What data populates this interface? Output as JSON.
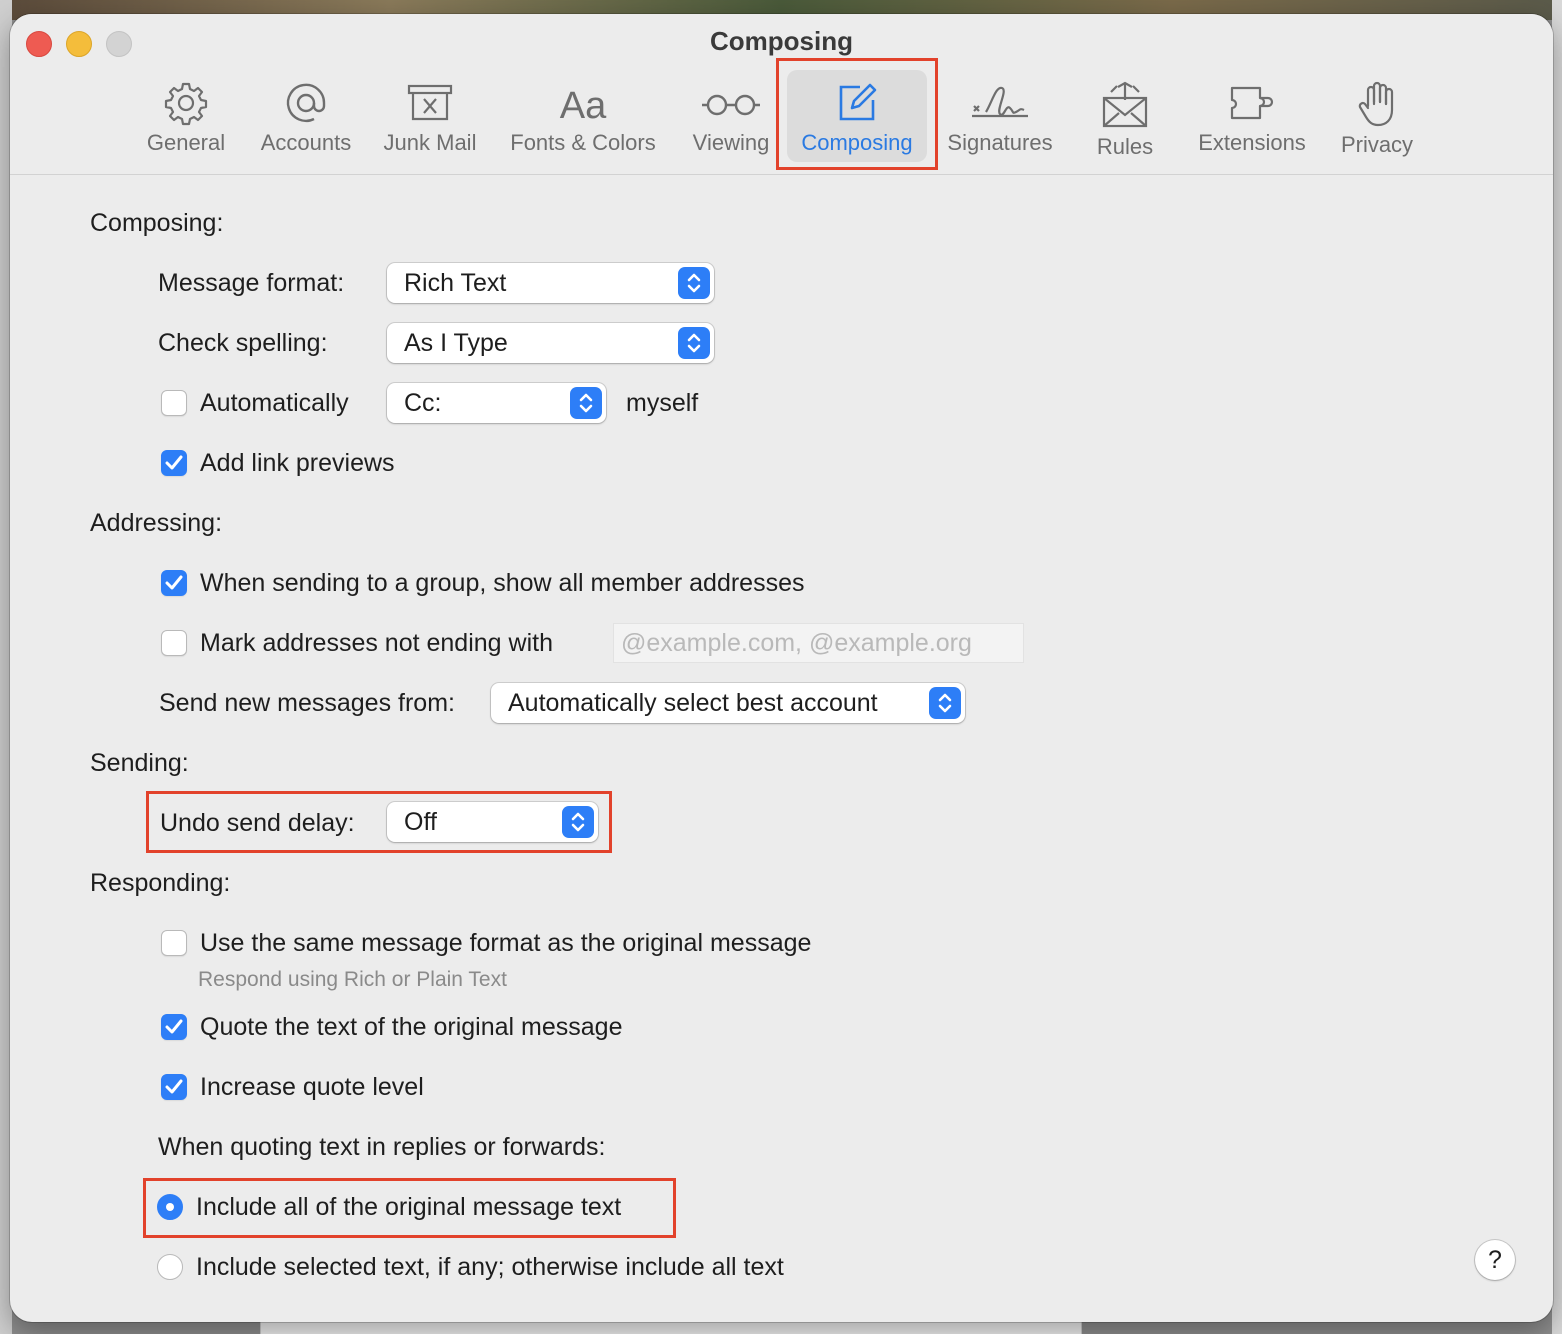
{
  "window": {
    "title": "Composing"
  },
  "toolbar": {
    "tabs": [
      {
        "label": "General",
        "icon": "gear-icon"
      },
      {
        "label": "Accounts",
        "icon": "at-sign-icon"
      },
      {
        "label": "Junk Mail",
        "icon": "junk-bin-icon"
      },
      {
        "label": "Fonts & Colors",
        "icon": "font-aa-icon"
      },
      {
        "label": "Viewing",
        "icon": "glasses-icon"
      },
      {
        "label": "Composing",
        "icon": "compose-pencil-icon",
        "selected": true
      },
      {
        "label": "Signatures",
        "icon": "signature-icon"
      },
      {
        "label": "Rules",
        "icon": "rules-envelope-icon"
      },
      {
        "label": "Extensions",
        "icon": "puzzle-icon"
      },
      {
        "label": "Privacy",
        "icon": "hand-icon"
      }
    ]
  },
  "composing": {
    "heading": "Composing:",
    "message_format_label": "Message format:",
    "message_format_value": "Rich Text",
    "check_spelling_label": "Check spelling:",
    "check_spelling_value": "As I Type",
    "auto_label": "Automatically",
    "auto_checked": false,
    "auto_cc_value": "Cc:",
    "auto_suffix": "myself",
    "link_previews_label": "Add link previews",
    "link_previews_checked": true
  },
  "addressing": {
    "heading": "Addressing:",
    "group_label": "When sending to a group, show all member addresses",
    "group_checked": true,
    "mark_label": "Mark addresses not ending with",
    "mark_checked": false,
    "mark_placeholder": "@example.com, @example.org",
    "send_from_label": "Send new messages from:",
    "send_from_value": "Automatically select best account"
  },
  "sending": {
    "heading": "Sending:",
    "undo_label": "Undo send delay:",
    "undo_value": "Off"
  },
  "responding": {
    "heading": "Responding:",
    "same_format_label": "Use the same message format as the original message",
    "same_format_checked": false,
    "same_format_hint": "Respond using Rich or Plain Text",
    "quote_label": "Quote the text of the original message",
    "quote_checked": true,
    "increase_label": "Increase quote level",
    "increase_checked": true,
    "quoting_label": "When quoting text in replies or forwards:",
    "include_all_label": "Include all of the original message text",
    "include_selected_label": "Include selected text, if any; otherwise include all text",
    "selected_option": "include_all"
  },
  "help": {
    "label": "?"
  },
  "colors": {
    "accent": "#2d7ef7",
    "highlight": "#e2422b"
  }
}
